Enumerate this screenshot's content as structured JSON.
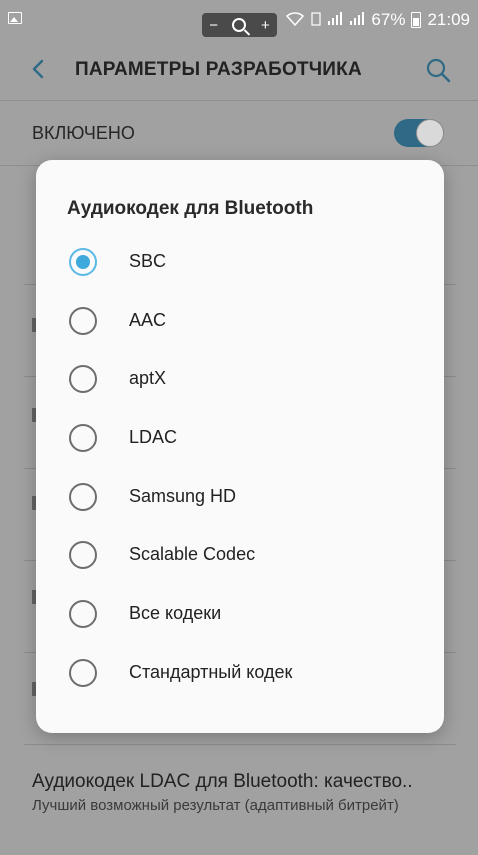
{
  "status_bar": {
    "zoom_minus": "−",
    "zoom_plus": "+",
    "battery_percent": "67%",
    "time": "21:09"
  },
  "app_bar": {
    "title": "ПАРАМЕТРЫ РАЗРАБОТЧИКА"
  },
  "master_switch": {
    "label": "ВКЛЮЧЕНО",
    "on": true,
    "accent_color": "#2e6a86"
  },
  "dialog": {
    "title": "Аудиокодек для Bluetooth",
    "selected_index": 0,
    "accent_color": "#3fa9dc",
    "options": [
      {
        "label": "SBC"
      },
      {
        "label": "AAC"
      },
      {
        "label": "aptX"
      },
      {
        "label": "LDAC"
      },
      {
        "label": "Samsung HD"
      },
      {
        "label": "Scalable Codec"
      },
      {
        "label": "Все кодеки"
      },
      {
        "label": "Стандартный кодек"
      }
    ]
  },
  "background_setting": {
    "title": "Аудиокодек LDAC для Bluetooth: качество..",
    "summary": "Лучший возможный результат (адаптивный битрейт)"
  }
}
